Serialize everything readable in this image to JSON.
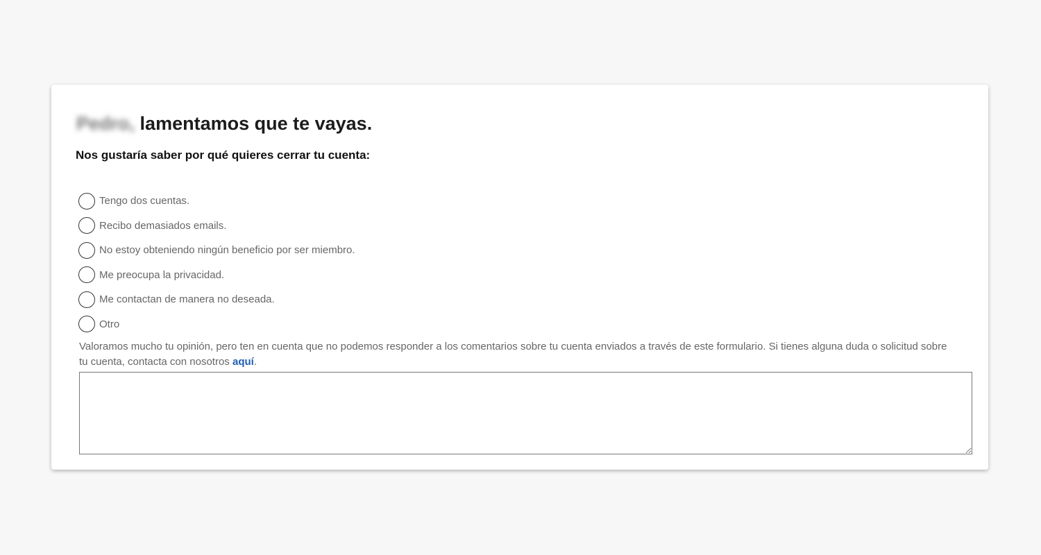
{
  "page": {
    "background": "#f7f7f7"
  },
  "header": {
    "user_name": "Pedro,",
    "title": "lamentamos que te vayas."
  },
  "question": "Nos gustaría saber por qué quieres cerrar tu cuenta:",
  "reasons": [
    {
      "label": "Tengo dos cuentas.",
      "selected": false
    },
    {
      "label": "Recibo demasiados emails.",
      "selected": false
    },
    {
      "label": "No estoy obteniendo ningún beneficio por ser miembro.",
      "selected": false
    },
    {
      "label": "Me preocupa la privacidad.",
      "selected": false
    },
    {
      "label": "Me contactan de manera no deseada.",
      "selected": false
    },
    {
      "label": "Otro",
      "selected": false
    }
  ],
  "note": {
    "text": "Valoramos mucho tu opinión, pero ten en cuenta que no podemos responder a los comentarios sobre tu cuenta enviados a través de este formulario. Si tienes alguna duda o solicitud sobre tu cuenta, contacta con nosotros ",
    "link_label": "aquí",
    "trailing": "."
  },
  "comments": {
    "value": "",
    "placeholder": ""
  },
  "colors": {
    "link": "#1f5fb4",
    "text_muted": "#666666",
    "heading": "#1c1c1c"
  }
}
